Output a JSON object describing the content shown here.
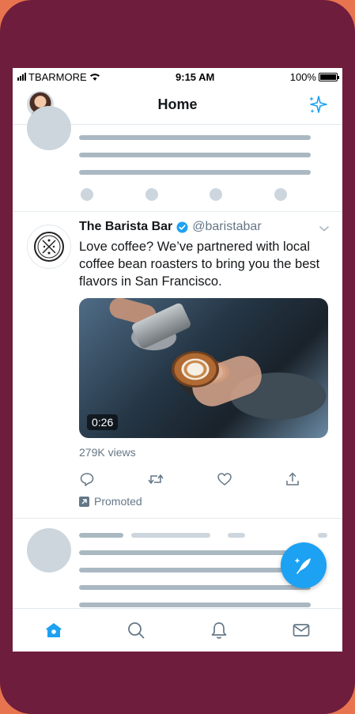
{
  "status_bar": {
    "carrier": "TBARMORE",
    "time": "9:15 AM",
    "battery": "100%"
  },
  "nav": {
    "title": "Home",
    "avatar_icon": "profile-avatar",
    "sparkle_icon": "sparkle-icon"
  },
  "tweet": {
    "display_name": "The Barista Bar",
    "handle": "@baristabar",
    "text": "Love coffee? We’ve partnered with local coffee bean roasters to bring you the best flavors in San Francisco.",
    "video_duration": "0:26",
    "views": "279K views",
    "promoted_label": "Promoted"
  },
  "tabs": [
    {
      "name": "home",
      "icon": "home-icon"
    },
    {
      "name": "search",
      "icon": "search-icon"
    },
    {
      "name": "notifications",
      "icon": "bell-icon"
    },
    {
      "name": "messages",
      "icon": "mail-icon"
    }
  ],
  "colors": {
    "accent": "#1da1f2",
    "background": "#e8744f",
    "phone": "#6e1d3c",
    "text_secondary": "#657786",
    "skeleton": "#aab8c2"
  }
}
